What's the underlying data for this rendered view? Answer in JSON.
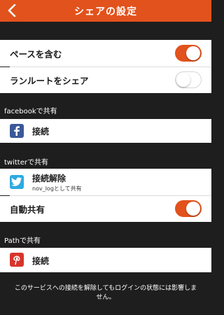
{
  "nav": {
    "title": "シェアの設定"
  },
  "settings": {
    "include_pace": {
      "label": "ペースを含む",
      "on": true
    },
    "share_route": {
      "label": "ランルートをシェア",
      "on": false
    }
  },
  "facebook": {
    "section": "facebookで共有",
    "action": "接続"
  },
  "twitter": {
    "section": "twitterで共有",
    "action": "接続解除",
    "account_note": "nov_logとして共有",
    "auto_share": {
      "label": "自動共有",
      "on": true
    }
  },
  "path": {
    "section": "Pathで共有",
    "action": "接続"
  },
  "footer": {
    "note": "このサービスへの接続を解除してもログインの状態には影響しません。"
  },
  "colors": {
    "accent": "#e2521c",
    "background": "#1e1e1e",
    "facebook": "#3b5998",
    "twitter": "#2daae1",
    "path": "#d6352b"
  }
}
